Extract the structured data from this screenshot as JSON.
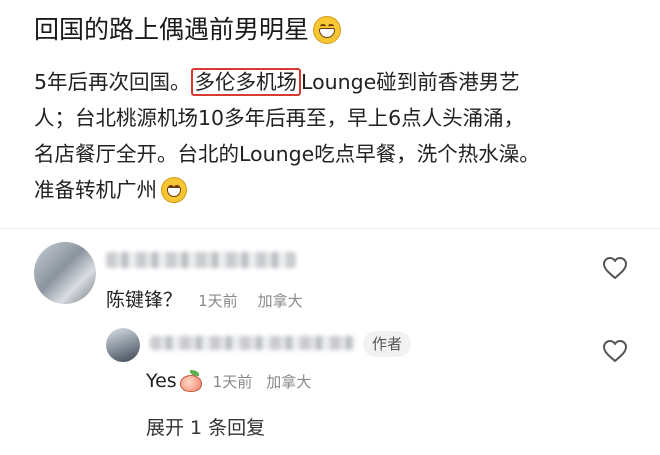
{
  "post": {
    "title": "回国的路上偶遇前男明星",
    "body_line1_prefix": "5年后再次回国。",
    "body_highlight": "多伦多机场",
    "body_line1_suffix": "Lounge碰到前香港男艺",
    "body_line2": "人；台北桃源机场10多年后再至，早上6点人头涌涌，",
    "body_line3": "名店餐厅全开。台北的Lounge吃点早餐，洗个热水澡。",
    "body_line4": "准备转机广州",
    "title_emoji_icon": "grinning-face-icon",
    "end_emoji_icon": "grinning-face-icon"
  },
  "comments": [
    {
      "text": "陈键锋？",
      "time": "1天前",
      "location": "加拿大",
      "like_icon": "heart-outline-icon"
    },
    {
      "text": "Yes",
      "author_tag": "作者",
      "emoji_icon": "peach-icon",
      "time": "1天前",
      "location": "加拿大",
      "like_icon": "heart-outline-icon"
    }
  ],
  "expand_replies": "展开 1 条回复",
  "colors": {
    "highlight_border": "#d83a33",
    "meta_text": "#8a8a8a",
    "author_tag_bg": "#f2f2f2"
  }
}
